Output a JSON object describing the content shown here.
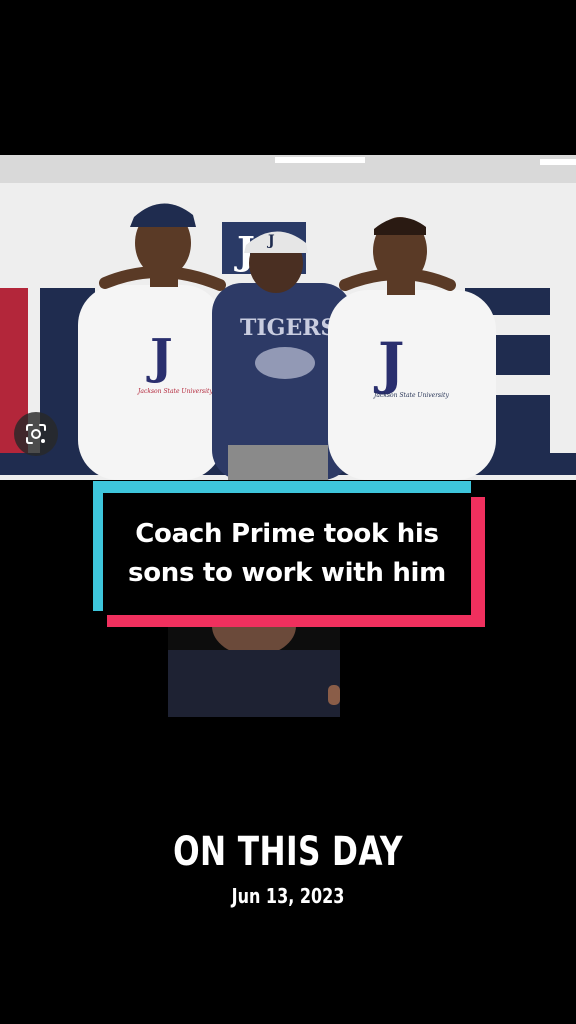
{
  "caption": {
    "lines": [
      "Coach Prime took his",
      "sons to work with him"
    ]
  },
  "photo": {
    "sign_letters": [
      "L",
      "I",
      "I",
      "E",
      "L"
    ],
    "hat_logo_letter": "J",
    "shirt_left_letter": "J",
    "shirt_left_text": "Jackson State University",
    "shirt_center_text": "TIGERS",
    "shirt_right_letter": "J",
    "shirt_right_text": "Jackson State University",
    "wall_logo_letter": "J"
  },
  "overlay": {
    "title": "ON THIS DAY",
    "date": "Jun 13, 2023"
  },
  "icons": {
    "lens": "google-lens-icon"
  },
  "colors": {
    "cyan": "#3ec6dc",
    "red": "#f0305e",
    "navy": "#1f2c4f"
  }
}
